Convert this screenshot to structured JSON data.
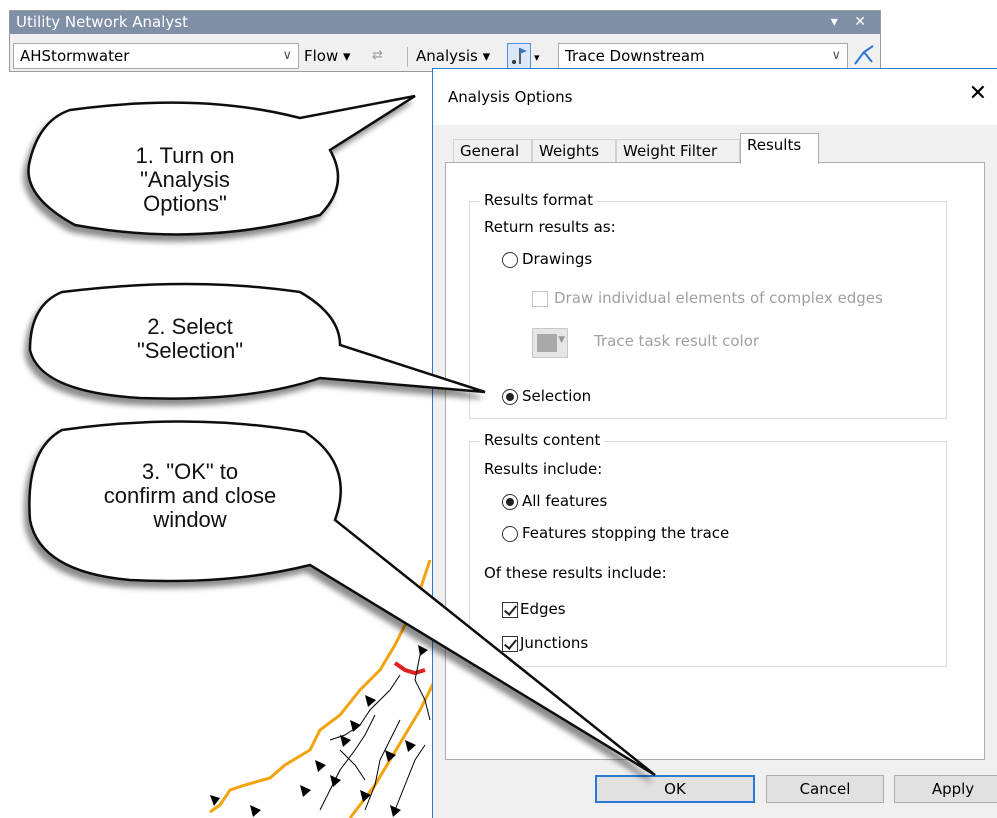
{
  "toolbar": {
    "title": "Utility Network Analyst",
    "title_controls": "▾ ✕",
    "network_combo": "AHStormwater",
    "flow_label": "Flow ▾",
    "analysis_label": "Analysis ▾",
    "trace_combo": "Trace Downstream"
  },
  "dialog": {
    "title": "Analysis Options",
    "close": "✕",
    "tabs": [
      "General",
      "Weights",
      "Weight Filter",
      "Results"
    ],
    "active_tab": "Results",
    "results_format": {
      "group_label": "Results format",
      "return_label": "Return results as:",
      "drawings_label": "Drawings",
      "draw_individual_label": "Draw individual elements of complex edges",
      "trace_color_label": "Trace task result color",
      "selection_label": "Selection"
    },
    "results_content": {
      "group_label": "Results content",
      "include_label": "Results include:",
      "all_features_label": "All features",
      "stopping_label": "Features stopping the trace",
      "of_these_label": "Of these results include:",
      "edges_label": "Edges",
      "junctions_label": "Junctions"
    },
    "buttons": {
      "ok": "OK",
      "cancel": "Cancel",
      "apply": "Apply"
    }
  },
  "callouts": {
    "c1": [
      "1. Turn on",
      "\"Analysis",
      "Options\""
    ],
    "c2": [
      "2. Select",
      "\"Selection\""
    ],
    "c3": [
      "3. \"OK\" to",
      "confirm and close",
      "window"
    ]
  },
  "colors": {
    "accent": "#2b79d6",
    "titlebar": "#7f8fa6",
    "orange_line": "#f2a20a",
    "red_line": "#e02020"
  }
}
